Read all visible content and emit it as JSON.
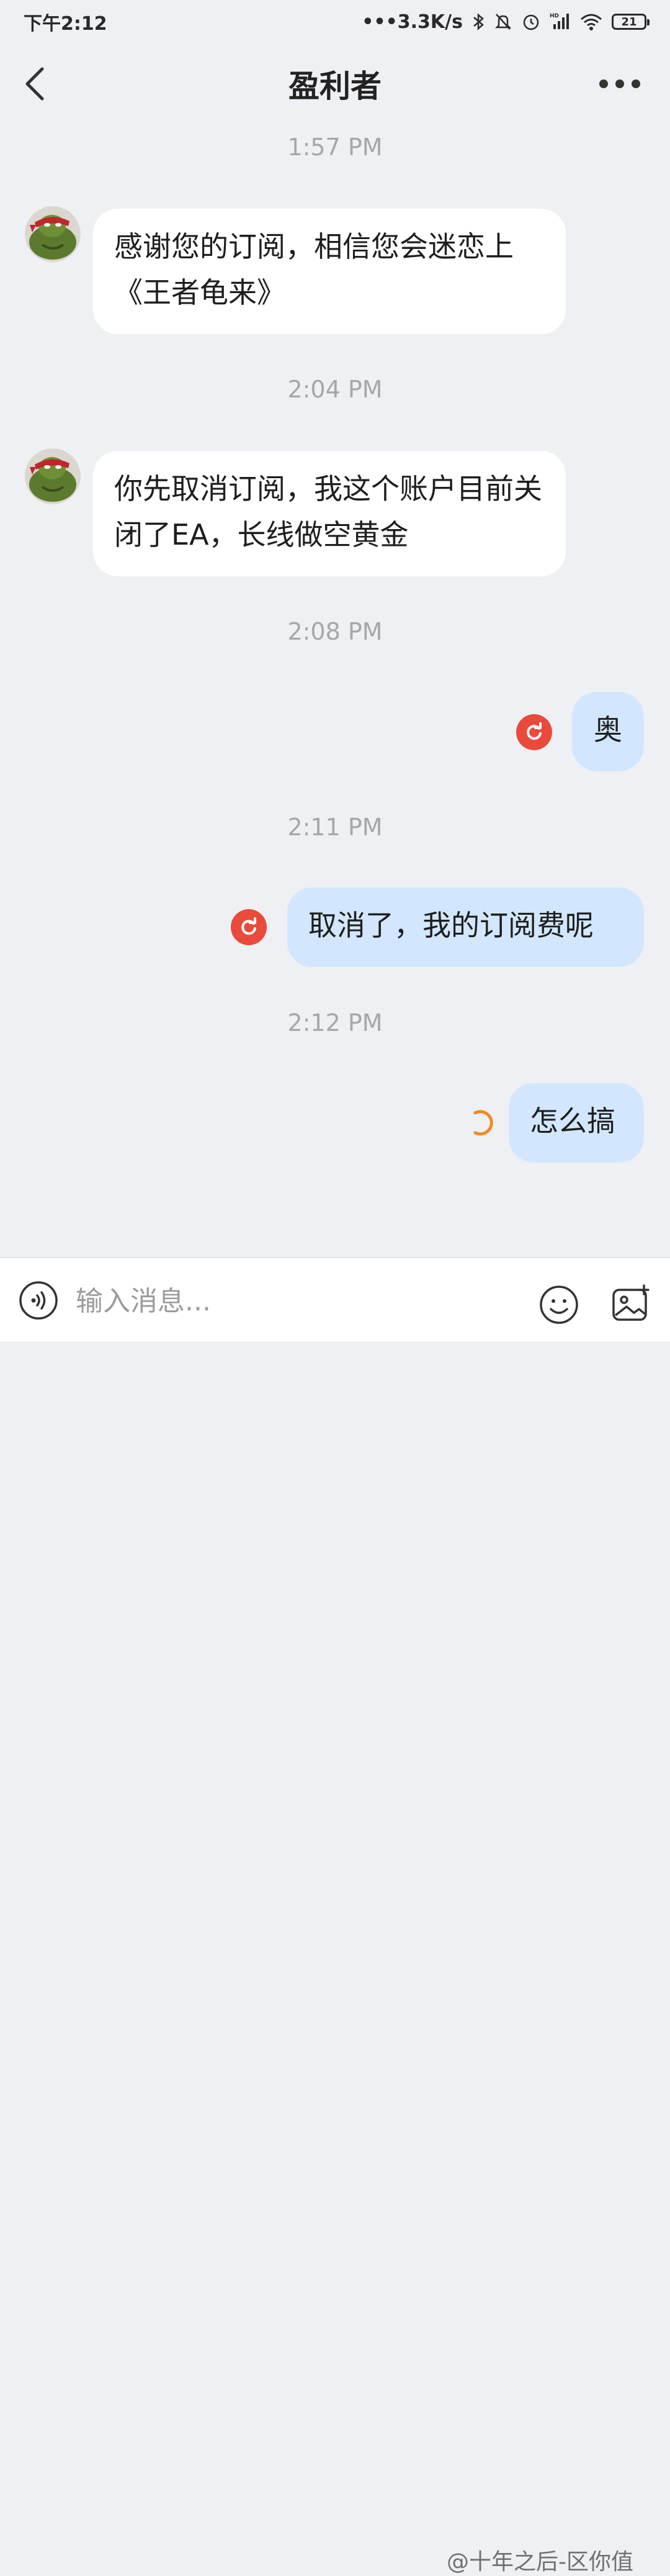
{
  "status_bar": {
    "time": "下午2:12",
    "net_speed": "3.3K/s",
    "battery": "21",
    "signal_tag": "HD"
  },
  "header": {
    "title": "盈利者"
  },
  "messages": [
    {
      "time": "1:57 PM",
      "direction": "in",
      "text": "感谢您的订阅，相信您会迷恋上《王者龟来》"
    },
    {
      "time": "2:04 PM",
      "direction": "in",
      "text": "你先取消订阅，我这个账户目前关闭了EA，长线做空黄金"
    },
    {
      "time": "2:08 PM",
      "direction": "out",
      "text": "奥",
      "state": "failed"
    },
    {
      "time": "2:11 PM",
      "direction": "out",
      "text": "取消了，我的订阅费呢",
      "state": "failed"
    },
    {
      "time": "2:12 PM",
      "direction": "out",
      "text": "怎么搞",
      "state": "sending"
    }
  ],
  "input": {
    "placeholder": "输入消息..."
  },
  "watermark": "@十年之后-区你值",
  "colors": {
    "background": "#eff0f3",
    "incoming_bubble": "#ffffff",
    "outgoing_bubble": "#d2e7fd",
    "retry_red": "#ea4a3b",
    "spinner_orange": "#f08a24"
  },
  "icons": [
    "back-icon",
    "more-icon",
    "retry-icon",
    "sending-spinner-icon",
    "voice-icon",
    "emoji-icon",
    "image-icon"
  ]
}
